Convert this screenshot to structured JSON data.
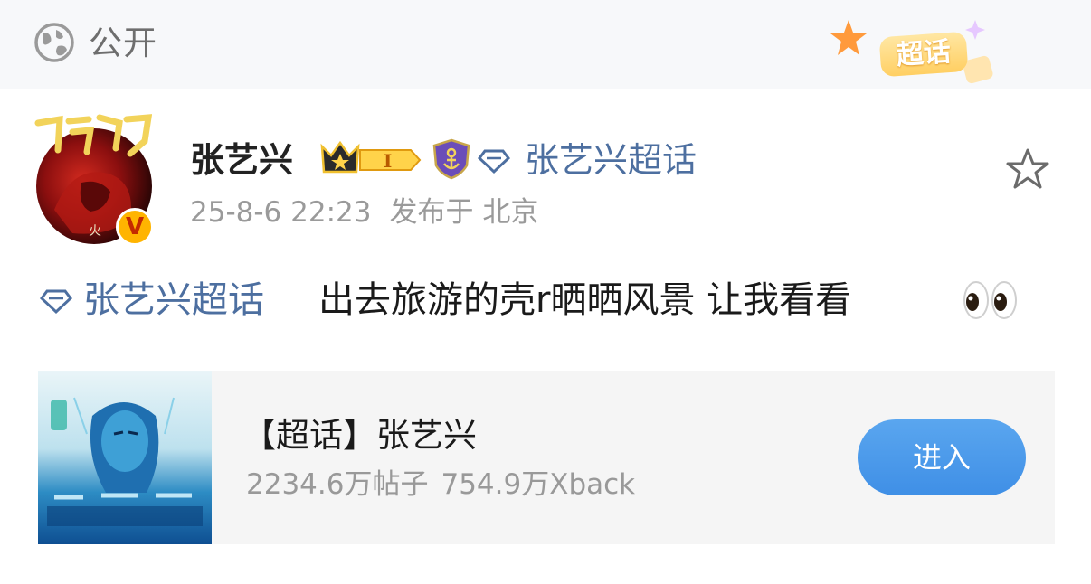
{
  "visibility": {
    "label": "公开",
    "badge": "超话"
  },
  "post": {
    "author": "张艺兴",
    "member_level": "I",
    "verified_mark": "V",
    "header_topic": "张艺兴超话",
    "timestamp": "25-8-6 22:23",
    "location": "发布于 北京",
    "body_topic": "张艺兴超话",
    "body_text": "出去旅游的壳r晒晒风景 让我看看"
  },
  "topic_card": {
    "title": "【超话】张艺兴",
    "posts_count": "2234.6万帖子",
    "followers_count": "754.9万Xback",
    "enter_label": "进入"
  },
  "colors": {
    "link": "#4d6fa0",
    "button": "#4a97ea",
    "meta_text": "#9a9a9a",
    "top_bar_bg": "#f7f8fa"
  },
  "icons": {
    "globe": "globe-icon",
    "crown": "crown-icon",
    "shield": "shield-icon",
    "diamond": "diamond-icon",
    "star": "star-icon",
    "eyes": "eyes-emoji"
  }
}
